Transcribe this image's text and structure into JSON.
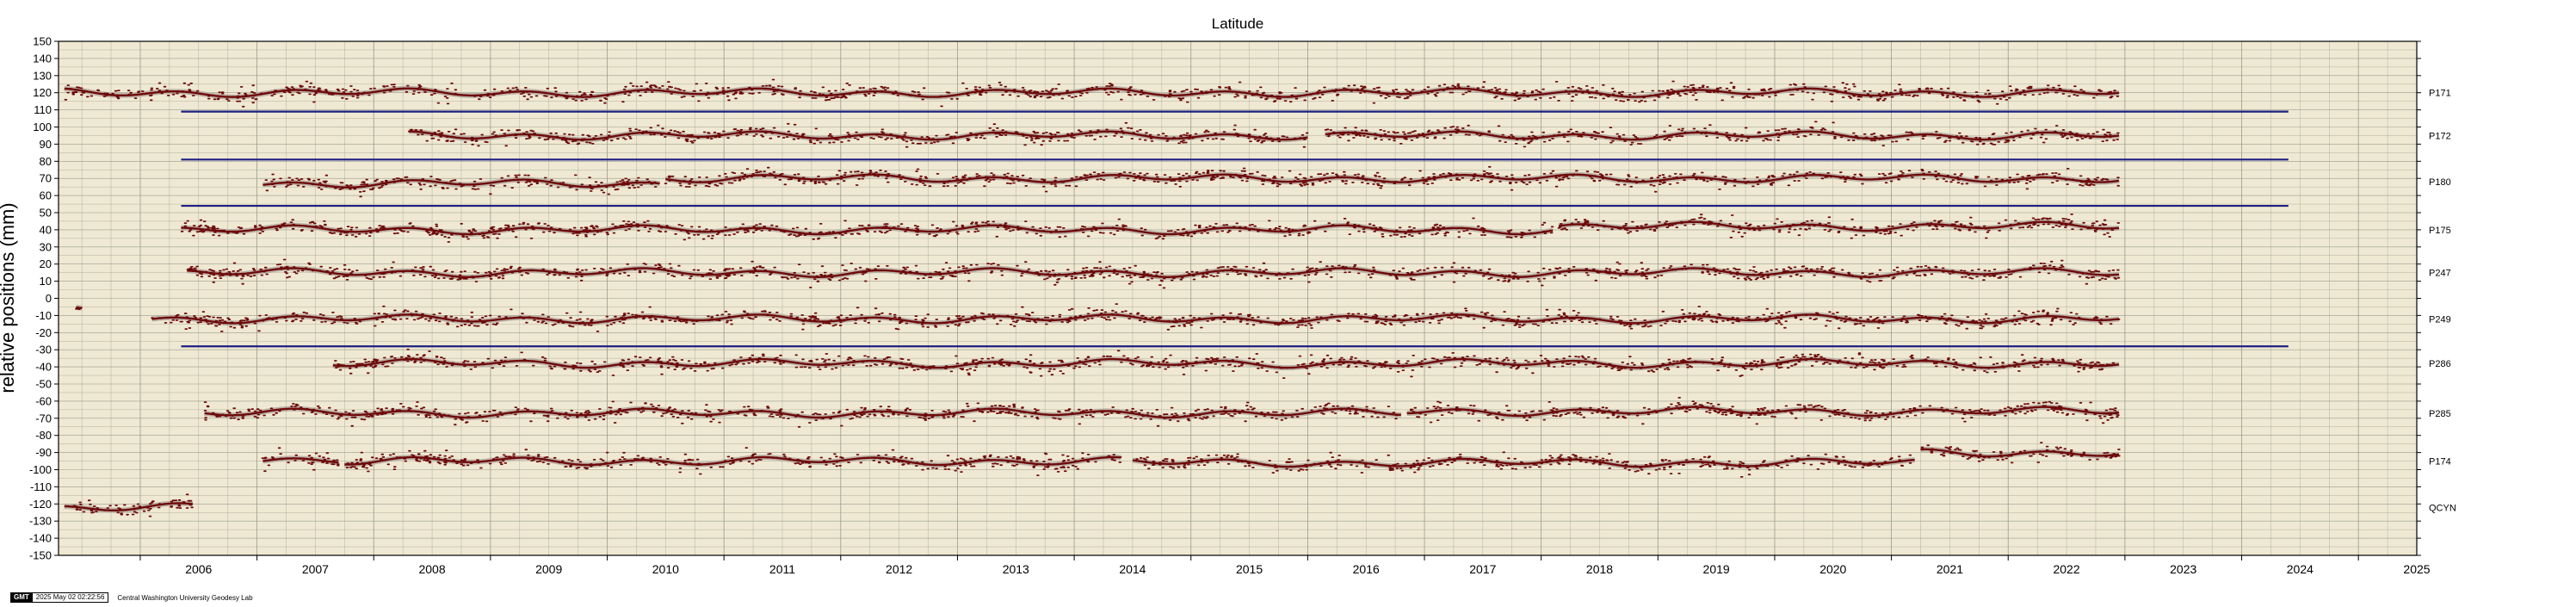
{
  "chart_data": {
    "type": "scatter",
    "title": "Latitude",
    "ylabel": "relative positions (mm)",
    "xlabel": "",
    "xlim": [
      2005.3,
      2025.5
    ],
    "ylim": [
      -150,
      150
    ],
    "yticks": [
      150,
      140,
      130,
      120,
      110,
      100,
      90,
      80,
      70,
      60,
      50,
      40,
      30,
      20,
      10,
      0,
      -10,
      -20,
      -30,
      -40,
      -50,
      -60,
      -70,
      -80,
      -90,
      -100,
      -110,
      -120,
      -130,
      -140,
      -150
    ],
    "xticks": [
      "2006",
      "2007",
      "2008",
      "2009",
      "2010",
      "2011",
      "2012",
      "2013",
      "2014",
      "2015",
      "2016",
      "2017",
      "2018",
      "2019",
      "2020",
      "2021",
      "2022",
      "2023",
      "2024",
      "2025"
    ],
    "grid": true,
    "colors": {
      "background": "#efe9d3",
      "grid": "#9a9a8a",
      "points": "#6e0a0a",
      "error_band": "#b4a8a0",
      "hline": "#1c1f80"
    },
    "stations": [
      {
        "name": "P171",
        "offset": 120,
        "segments": [
          [
            2005.35,
            2022.95,
            0
          ]
        ]
      },
      {
        "name": "P172",
        "offset": 95,
        "segments": [
          [
            2008.3,
            2016.0,
            0
          ],
          [
            2016.15,
            2022.95,
            0
          ]
        ]
      },
      {
        "name": "P180",
        "offset": 68,
        "segments": [
          [
            2007.05,
            2010.45,
            -1
          ],
          [
            2010.5,
            2022.95,
            2
          ]
        ]
      },
      {
        "name": "P175",
        "offset": 40,
        "segments": [
          [
            2006.35,
            2018.1,
            0
          ],
          [
            2018.15,
            2022.95,
            2
          ]
        ]
      },
      {
        "name": "P247",
        "offset": 15,
        "segments": [
          [
            2006.4,
            2022.95,
            0
          ]
        ]
      },
      {
        "name": "P249",
        "offset": -12,
        "segments": [
          [
            2005.45,
            2005.5,
            5
          ],
          [
            2006.1,
            2022.95,
            0
          ]
        ]
      },
      {
        "name": "P286",
        "offset": -38,
        "segments": [
          [
            2007.65,
            2022.95,
            0
          ]
        ]
      },
      {
        "name": "P285",
        "offset": -67,
        "segments": [
          [
            2006.55,
            2016.8,
            0
          ],
          [
            2016.85,
            2022.95,
            1
          ]
        ]
      },
      {
        "name": "P174",
        "offset": -95,
        "segments": [
          [
            2007.05,
            2007.7,
            1
          ],
          [
            2007.75,
            2014.4,
            0
          ],
          [
            2014.5,
            2021.2,
            -1
          ],
          [
            2021.25,
            2022.95,
            5
          ]
        ]
      },
      {
        "name": "QCYN",
        "offset": -122,
        "segments": [
          [
            2005.35,
            2006.45,
            0
          ]
        ]
      }
    ],
    "hlines": [
      {
        "y": 109,
        "x": [
          2006.35,
          2024.4
        ]
      },
      {
        "y": 81,
        "x": [
          2006.35,
          2024.4
        ]
      },
      {
        "y": 54,
        "x": [
          2006.35,
          2024.4
        ]
      },
      {
        "y": -28,
        "x": [
          2006.35,
          2024.4
        ]
      }
    ]
  },
  "footer": {
    "logo": "GMT",
    "timestamp": "2025 May 02 02:22:56",
    "lab": "Central Washington University Geodesy Lab"
  }
}
